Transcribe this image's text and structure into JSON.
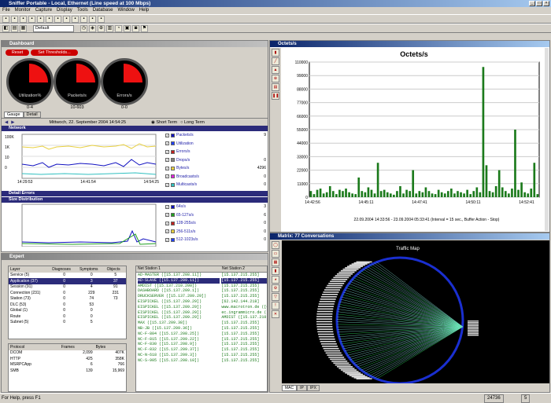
{
  "window": {
    "title": "Sniffer Portable - Local, Ethernet (Line speed at 100 Mbps)",
    "controls": [
      "_",
      "□",
      "×"
    ]
  },
  "menu": [
    "File",
    "Monitor",
    "Capture",
    "Display",
    "Tools",
    "Database",
    "Window",
    "Help"
  ],
  "toolbar": {
    "profile": "Default"
  },
  "dashboard": {
    "title": "Dashboard",
    "reset": "Reset",
    "set_thresholds": "Set Thresholds...",
    "gauges": [
      {
        "label": "Utilization%",
        "value": "0-4"
      },
      {
        "label": "Packets/s",
        "value": "10-603"
      },
      {
        "label": "Errors/s",
        "value": "0-0"
      }
    ],
    "tabs": [
      "Gauge",
      "Detail"
    ],
    "date": "Mittwoch, 22. September 2004 14:54:25",
    "short_term": "Short Term",
    "long_term": "Long Term",
    "network_label": "Network",
    "yaxis": [
      "100K",
      "1K",
      "10",
      "0"
    ],
    "xaxis": [
      "14:29:53",
      "14:41:54",
      "14:54:25"
    ],
    "legend": [
      {
        "name": "Packets/s",
        "value": "9",
        "color": "#1010c0"
      },
      {
        "name": "Utilization",
        "value": "",
        "color": "#2040ff"
      },
      {
        "name": "Errors/s",
        "value": "",
        "color": "#c02020"
      },
      {
        "name": "Drops/s",
        "value": "0",
        "color": "#808080"
      },
      {
        "name": "Bytes/s",
        "value": "4296",
        "color": "#e8d040"
      },
      {
        "name": "Broadcasts/s",
        "value": "0",
        "color": "#e020e0"
      },
      {
        "name": "Multicasts/s",
        "value": "0",
        "color": "#30c0c0"
      }
    ],
    "detail_errors": "Detail Errors",
    "size_distribution": "Size Distribution",
    "size_legend": [
      {
        "name": "64s/s",
        "value": "3",
        "color": "#1010c0"
      },
      {
        "name": "65-127s/s",
        "value": "6",
        "color": "#20a020"
      },
      {
        "name": "128-255s/s",
        "value": "0",
        "color": "#c02020"
      },
      {
        "name": "256-511s/s",
        "value": "0",
        "color": "#e8d040"
      },
      {
        "name": "512-1023s/s",
        "value": "0",
        "color": "#2040ff"
      }
    ]
  },
  "expert": {
    "title": "Expert",
    "headers": [
      "Layer",
      "Diagnoses",
      "Symptoms",
      "Objects"
    ],
    "rows": [
      [
        "Service (5)",
        "0",
        "0",
        "5"
      ],
      [
        "Application (37)",
        "0",
        "3",
        "37"
      ],
      [
        "Session (91)",
        "0",
        "4",
        "91"
      ],
      [
        "Connection (231)",
        "0",
        "229",
        "231"
      ],
      [
        "Station (73)",
        "0",
        "74",
        "73"
      ],
      [
        "DLC (53)",
        "0",
        "53",
        ""
      ],
      [
        "Global (1)",
        "0",
        "0",
        ""
      ],
      [
        "Route",
        "0",
        "0",
        ""
      ],
      [
        "Subnet (5)",
        "0",
        "5",
        ""
      ]
    ],
    "proto_headers": [
      "Protocol",
      "Frames",
      "Bytes"
    ],
    "protos": [
      [
        "DCOM",
        "2,099",
        "407K"
      ],
      [
        "HTTP",
        "425",
        "358K"
      ],
      [
        "MSRPCApp",
        "6",
        "766"
      ],
      [
        "SMB",
        "139",
        "15,969"
      ]
    ],
    "net_headers": [
      "Net Station 1",
      "Net Station 2"
    ],
    "stations": [
      [
        "AD-MASTER ([15.137.208.11])",
        "[15.137.215.255]"
      ],
      [
        "AD-SLAVE ([15.137.209.11])",
        "[15.137.215.255]"
      ],
      [
        "AMDIST ([15.137.210.200])",
        "[15.137.215.255]"
      ],
      [
        "DASHBOARD ([15.137.209.1])",
        "[15.137.215.255]"
      ],
      [
        "DRUCKSERVER ([15.137.209.29])",
        "[15.137.215.255]"
      ],
      [
        "EISPICKEL ([15.137.209.29])",
        "[62.142.144.218]"
      ],
      [
        "EISPICKEL ([15.137.209.29])",
        "www.macrotron.de ([62.1"
      ],
      [
        "EISPICKEL ([15.137.209.29])",
        "ec.ingrammicro.de ([62."
      ],
      [
        "EISPICKEL ([15.137.209.29])",
        "AMDIST ([15.137.210.20"
      ],
      [
        "MAX ([15.137.209.38])",
        "[15.137.215.255]"
      ],
      [
        "NB-JB ([15.137.209.36])",
        "[15.137.215.255]"
      ],
      [
        "NC-F-804 ([15.137.208.25])",
        "[15.137.215.255]"
      ],
      [
        "NC-F-815 ([15.137.209.22])",
        "[15.137.215.255]"
      ],
      [
        "NC-F-830 ([15.137.208.9])",
        "[15.137.215.255]"
      ],
      [
        "NC-F-832 ([15.137.209.37])",
        "[15.137.215.255]"
      ],
      [
        "NC-N-618 ([15.137.209.3])",
        "[15.137.215.255]"
      ],
      [
        "NC-S-905 ([15.137.208.10])",
        "[15.137.215.255]"
      ]
    ]
  },
  "octets": {
    "title": "Octets/s",
    "chart_title": "Octets/s",
    "footer": "22.09.2004 14:33:56 - 23.09.2004 05:33:41   (Interval = 15 sec., Buffer Action - Stop)",
    "chart_data": {
      "type": "bar",
      "title": "Octets/s",
      "ylim": [
        0,
        110000
      ],
      "yticks": [
        "0",
        "11000",
        "22000",
        "33000",
        "44000",
        "55000",
        "66000",
        "77000",
        "88000",
        "99000",
        "110000"
      ],
      "xticks": [
        "14:42:56",
        "14:45:11",
        "14:47:41",
        "14:50:11",
        "14:52:41"
      ],
      "values": [
        5000,
        2500,
        6000,
        7000,
        3000,
        4000,
        9000,
        5000,
        2500,
        6000,
        5000,
        7000,
        4000,
        3000,
        2500,
        16000,
        5000,
        4000,
        8000,
        6000,
        3000,
        28000,
        5000,
        6000,
        4000,
        3000,
        2000,
        5000,
        9000,
        3000,
        6000,
        5000,
        22000,
        3000,
        5000,
        4000,
        8000,
        5000,
        3000,
        2500,
        6000,
        4000,
        3000,
        5000,
        7000,
        3000,
        5000,
        4000,
        3000,
        6000,
        2500,
        5000,
        8000,
        4000,
        106000,
        26000,
        5000,
        4000,
        9000,
        22000,
        8000,
        5000,
        3000,
        7000,
        55000,
        6000,
        12000,
        4000,
        3000,
        7000,
        28000,
        2500
      ]
    }
  },
  "matrix": {
    "title": "Matrix: 77 Conversations",
    "map_title": "Traffic Map",
    "tabs": [
      "MAC",
      "IP",
      "IPX"
    ]
  },
  "status": {
    "help": "For Help, press F1",
    "count": "24736",
    "page": "5"
  }
}
